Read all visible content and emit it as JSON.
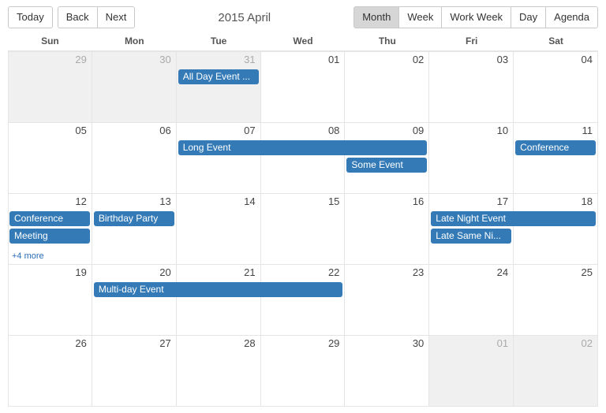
{
  "toolbar": {
    "today": "Today",
    "back": "Back",
    "next": "Next",
    "title": "2015 April",
    "views": [
      "Month",
      "Week",
      "Work Week",
      "Day",
      "Agenda"
    ],
    "active_view": "Month"
  },
  "week_days": [
    "Sun",
    "Mon",
    "Tue",
    "Wed",
    "Thu",
    "Fri",
    "Sat"
  ],
  "cells": [
    {
      "n": "29",
      "out": true
    },
    {
      "n": "30",
      "out": true
    },
    {
      "n": "31",
      "out": true
    },
    {
      "n": "01"
    },
    {
      "n": "02"
    },
    {
      "n": "03"
    },
    {
      "n": "04"
    },
    {
      "n": "05"
    },
    {
      "n": "06"
    },
    {
      "n": "07"
    },
    {
      "n": "08"
    },
    {
      "n": "09"
    },
    {
      "n": "10"
    },
    {
      "n": "11"
    },
    {
      "n": "12",
      "more": "+4 more"
    },
    {
      "n": "13"
    },
    {
      "n": "14"
    },
    {
      "n": "15"
    },
    {
      "n": "16"
    },
    {
      "n": "17"
    },
    {
      "n": "18"
    },
    {
      "n": "19"
    },
    {
      "n": "20"
    },
    {
      "n": "21"
    },
    {
      "n": "22"
    },
    {
      "n": "23"
    },
    {
      "n": "24"
    },
    {
      "n": "25"
    },
    {
      "n": "26"
    },
    {
      "n": "27"
    },
    {
      "n": "28"
    },
    {
      "n": "29"
    },
    {
      "n": "30"
    },
    {
      "n": "01",
      "out": true
    },
    {
      "n": "02",
      "out": true
    }
  ],
  "events": [
    {
      "title": "All Day Event ...",
      "row": 0,
      "col": 2,
      "span": 1,
      "slot": 0
    },
    {
      "title": "Long Event",
      "row": 1,
      "col": 2,
      "span": 3,
      "slot": 0
    },
    {
      "title": "Some Event",
      "row": 1,
      "col": 4,
      "span": 1,
      "slot": 1
    },
    {
      "title": "Conference",
      "row": 1,
      "col": 6,
      "span": 1,
      "slot": 0
    },
    {
      "title": "Conference",
      "row": 2,
      "col": 0,
      "span": 1,
      "slot": 0
    },
    {
      "title": "Meeting",
      "row": 2,
      "col": 0,
      "span": 1,
      "slot": 1
    },
    {
      "title": "Birthday Party",
      "row": 2,
      "col": 1,
      "span": 1,
      "slot": 0
    },
    {
      "title": "Late Night Event",
      "row": 2,
      "col": 5,
      "span": 2,
      "slot": 0
    },
    {
      "title": "Late Same Ni...",
      "row": 2,
      "col": 5,
      "span": 1,
      "slot": 1
    },
    {
      "title": "Multi-day Event",
      "row": 3,
      "col": 1,
      "span": 3,
      "slot": 0
    }
  ]
}
